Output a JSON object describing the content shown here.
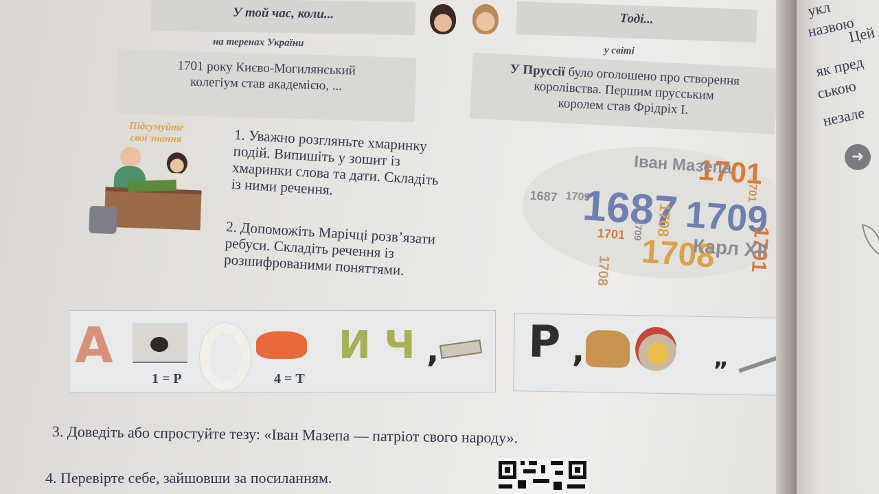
{
  "header": {
    "left_title": "У той час, коли...",
    "right_title": "Тоді...",
    "left_subtitle": "на теренах України",
    "right_subtitle": "у світі"
  },
  "facts": {
    "ukraine": [
      "1701 року Києво-Могилянський",
      "колегіум став академією, ..."
    ],
    "world_bold": "У Пруссії",
    "world": [
      " було оголошено про створення",
      "королівства. Першим прусським",
      "королем став Фрідріх І."
    ]
  },
  "badge": {
    "title_line1": "Підсумуйте",
    "title_line2": "свої знання"
  },
  "tasks": {
    "task1": [
      "1. Уважно розгляньте хмаринку",
      "подій. Випишіть у зошит із",
      "хмаринки  слова та дати. Складіть",
      "із ними речення."
    ],
    "task2": [
      "2. Допоможіть Марічці розв’язати",
      "ребуси. Складіть речення із",
      "розшифрованими поняттями."
    ]
  },
  "word_cloud": [
    {
      "text": "1701",
      "color": "#d87a3a"
    },
    {
      "text": "1701",
      "color": "#d98a4a"
    },
    {
      "text": "Іван Мазепа",
      "color": "#8e8b95"
    },
    {
      "text": "1687",
      "color": "#6f7fb0"
    },
    {
      "text": "1708",
      "color": "#d9a24e"
    },
    {
      "text": "1709",
      "color": "#6f7fb0"
    },
    {
      "text": "1701",
      "color": "#d87a3a"
    },
    {
      "text": "1708",
      "color": "#d9a24e"
    },
    {
      "text": "Карл XII",
      "color": "#8e8b95"
    },
    {
      "text": "1701",
      "color": "#d87a3a"
    },
    {
      "text": "1687",
      "color": "#8e8b95"
    },
    {
      "text": "1709",
      "color": "#8e8b95"
    },
    {
      "text": "1708",
      "color": "#c79b6e"
    },
    {
      "text": "1709",
      "color": "#8e8b95"
    }
  ],
  "rebus": {
    "left": {
      "letter_a": "А",
      "code1": "1 = Р",
      "code2": "4 = Т",
      "letters": "И Ч",
      "comma": ","
    },
    "right": {
      "letter_r": "Р",
      "comma1": ",",
      "comma2": "„",
      "comma3": "„"
    }
  },
  "task3": "3. Доведіть або спростуйте тезу: «Іван Мазепа — патріот свого народу».",
  "task4": "4. Перевірте себе, зайшовши за посиланням.",
  "next_page": [
    "укл",
    "назвою",
    "Цей",
    "як пред",
    "ською",
    "незале"
  ]
}
